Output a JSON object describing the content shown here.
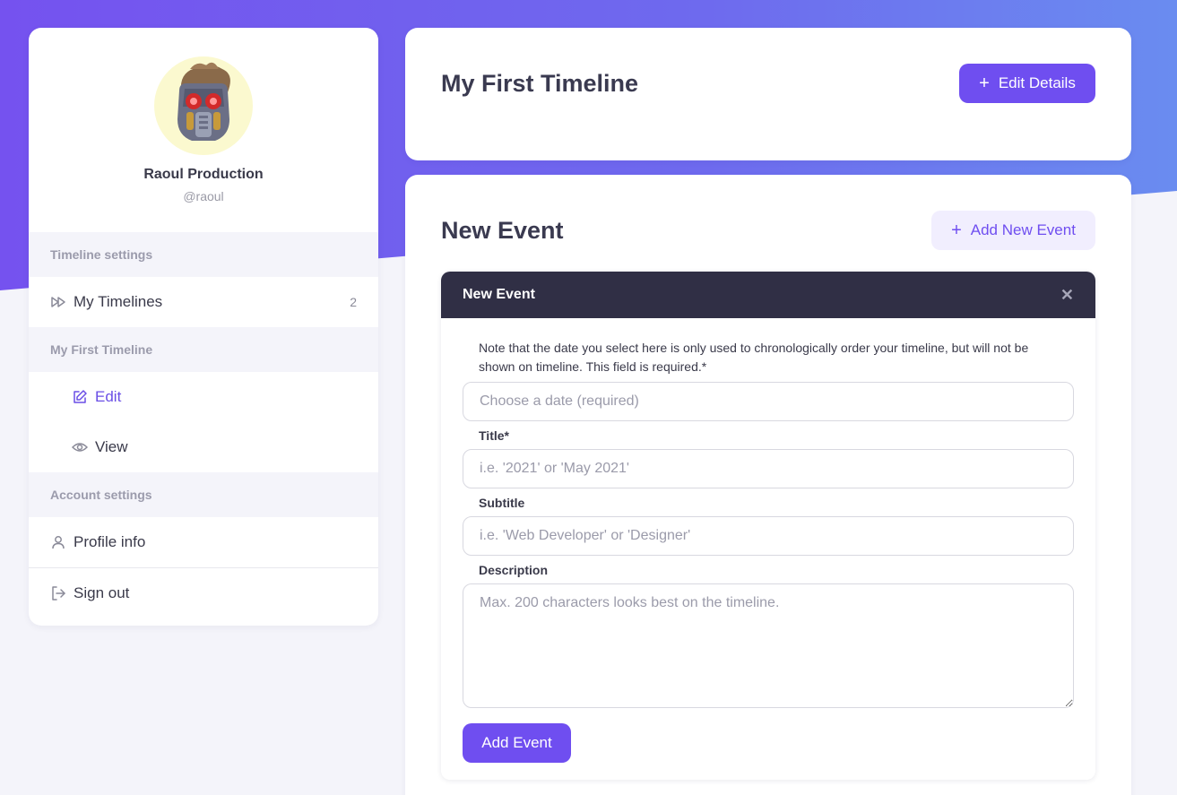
{
  "profile": {
    "name": "Raoul Production",
    "handle": "@raoul"
  },
  "sidebar": {
    "sections": [
      {
        "header": "Timeline settings"
      },
      {
        "header": "My First Timeline"
      },
      {
        "header": "Account settings"
      }
    ],
    "my_timelines": {
      "label": "My Timelines",
      "count": "2",
      "icon": "fast-forward-icon"
    },
    "edit": {
      "label": "Edit",
      "icon": "edit-icon"
    },
    "view": {
      "label": "View",
      "icon": "eye-icon"
    },
    "profile_info": {
      "label": "Profile info",
      "icon": "user-icon"
    },
    "sign_out": {
      "label": "Sign out",
      "icon": "sign-out-icon"
    }
  },
  "header_card": {
    "title": "My First Timeline",
    "edit_details_label": "Edit Details"
  },
  "main_card": {
    "title": "New Event",
    "add_new_event_label": "Add New Event"
  },
  "panel": {
    "title": "New Event",
    "note": "Note that the date you select here is only used to chronologically order your timeline, but will not be shown on timeline. This field is required.*",
    "date_placeholder": "Choose a date (required)",
    "title_label": "Title*",
    "title_placeholder": "i.e. '2021' or 'May 2021'",
    "subtitle_label": "Subtitle",
    "subtitle_placeholder": "i.e. 'Web Developer' or 'Designer'",
    "description_label": "Description",
    "description_placeholder": "Max. 200 characters looks best on the timeline.",
    "submit_label": "Add Event"
  },
  "colors": {
    "accent": "#6f4ef0",
    "panel_header": "#302f45",
    "gradient_start": "#7552ef",
    "gradient_end": "#6a8cf0"
  }
}
